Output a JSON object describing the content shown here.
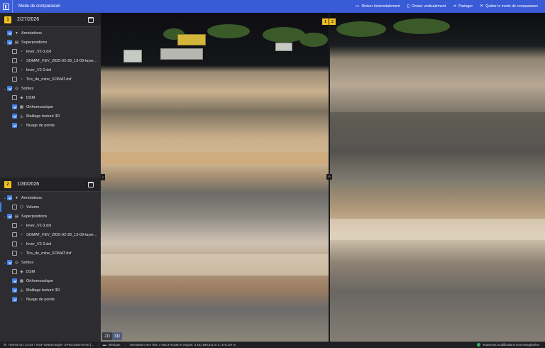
{
  "app": {
    "title": "Mode de comparaison"
  },
  "toolbar": {
    "split_horizontal": "Diviser horizontalement",
    "split_vertical": "Diviser verticalement",
    "share": "Partager",
    "quit": "Quitter le mode de comparaison"
  },
  "panel1": {
    "badge": "1",
    "date": "2/27/2026",
    "annotations": "Annotations",
    "superpositions": "Superpositions",
    "overlays": [
      "lever_V2-3.dxf",
      "SOMAT_FEV_2025-02-28_13-09-layer...",
      "lever_V2-2.dxf",
      "Tirs_de_mine_SOMAT.dxf"
    ],
    "outputs": "Sorties",
    "output_items": [
      "DSM",
      "Orthomosaïque",
      "Maillage texturé 3D",
      "Nuage de points"
    ]
  },
  "panel2": {
    "badge": "2",
    "date": "1/30/2026",
    "annotations": "Annotations",
    "volume": "Volume",
    "superpositions": "Superpositions",
    "overlays": [
      "lever_V2-3.dxf",
      "SOMAT_FEV_2025-02-28_13-09-layer...",
      "lever_V2-2.dxf",
      "Tirs_de_mine_SOMAT.dxf"
    ],
    "outputs": "Sorties",
    "output_items": [
      "DSM",
      "Orthomosaïque",
      "Maillage texturé 3D",
      "Nuage de points"
    ]
  },
  "viewport": {
    "badge_left": "1",
    "badge_right": "2",
    "mode_2d": "2D",
    "mode_3d": "3D"
  },
  "status": {
    "crs": "RGF93 v1 / CC44 + NGF-IGN69 height - EPSG:3944+5720 [...",
    "units": "Métrique",
    "orientation": "Orientation vers l'est: 2 053 276,638 m   Origine: 3 181 590,611 m   Z: 479,137 m",
    "saved": "Toutes les modifications sont enregistrées"
  },
  "colors": {
    "accent": "#3a5bd6",
    "badge": "#f3c11f",
    "checkbox": "#3f7fe6",
    "ok": "#35b369"
  }
}
